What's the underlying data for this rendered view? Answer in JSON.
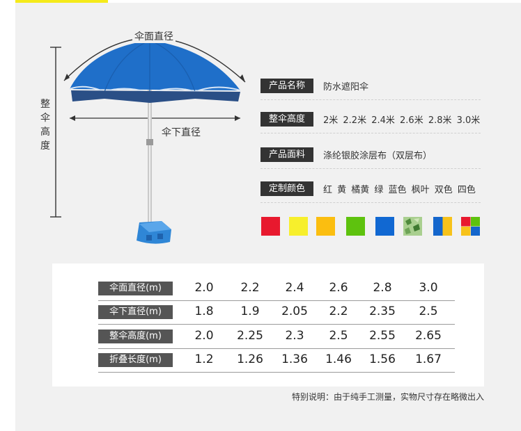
{
  "page": {
    "accent_color": "#f5ea1a",
    "panel_color": "#f1f1f1"
  },
  "illustration": {
    "canopy_diameter_label": "伞面直径",
    "under_diameter_label": "伞下直径",
    "height_chars": [
      "整",
      "伞",
      "高",
      "度"
    ],
    "canopy_color": "#1f6fc9",
    "base_color": "#2f86d6"
  },
  "info": [
    {
      "label": "产品名称",
      "value": "防水遮阳伞"
    },
    {
      "label": "整伞高度",
      "value": "2米 2.2米 2.4米 2.6米 2.8米 3.0米"
    },
    {
      "label": "产品面料",
      "value": "涤纶银胶涂层布（双层布）"
    },
    {
      "label": "定制颜色",
      "value": "红 黄 橘黄 绿 蓝色 枫叶 双色 四色"
    }
  ],
  "swatches": [
    {
      "name": "red",
      "color": "#e8192e"
    },
    {
      "name": "yellow",
      "color": "#f7ef2c"
    },
    {
      "name": "orange-yellow",
      "color": "#fbbe10"
    },
    {
      "name": "green",
      "color": "#5ec20e"
    },
    {
      "name": "blue",
      "color": "#1168d2"
    },
    {
      "name": "maple",
      "color": "#7fae66"
    },
    {
      "name": "two-color",
      "colors": [
        "#1466cc",
        "#f7c21a"
      ]
    },
    {
      "name": "four-color",
      "colors": [
        "#e8192e",
        "#5ec20e",
        "#f7c21a",
        "#1466cc"
      ]
    }
  ],
  "spec_table": {
    "rows": [
      {
        "header": "伞面直径(m)",
        "values": [
          "2.0",
          "2.2",
          "2.4",
          "2.6",
          "2.8",
          "3.0"
        ]
      },
      {
        "header": "伞下直径(m)",
        "values": [
          "1.8",
          "1.9",
          "2.05",
          "2.2",
          "2.35",
          "2.5"
        ]
      },
      {
        "header": "整伞高度(m)",
        "values": [
          "2.0",
          "2.25",
          "2.3",
          "2.5",
          "2.55",
          "2.65"
        ]
      },
      {
        "header": "折叠长度(m)",
        "values": [
          "1.2",
          "1.26",
          "1.36",
          "1.46",
          "1.56",
          "1.67"
        ]
      }
    ]
  },
  "note": "特别说明：由于纯手工测量，实物尺寸存在略微出入"
}
